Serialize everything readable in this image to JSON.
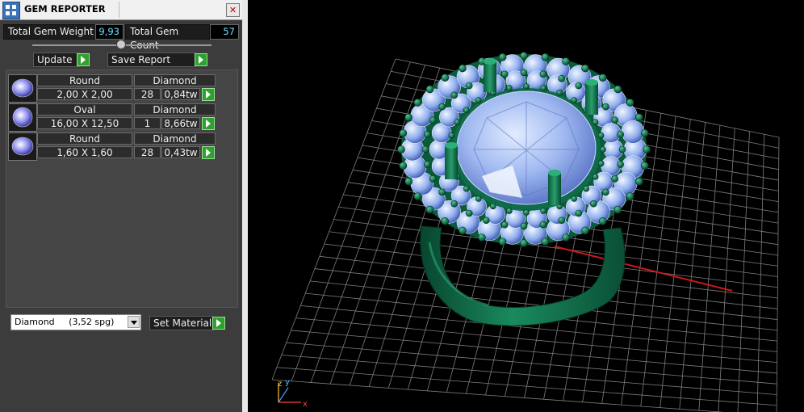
{
  "window": {
    "title": "GEM REPORTER",
    "close_glyph": "✕"
  },
  "stats": {
    "total_weight_label": "Total Gem Weight",
    "total_weight_value": "9,93",
    "total_count_label": "Total Gem Count",
    "total_count_value": "57"
  },
  "buttons": {
    "update": "Update",
    "save_report": "Save Report",
    "set_material": "Set Material"
  },
  "gems": [
    {
      "shape": "Round",
      "material": "Diamond",
      "size": "2,00 X 2,00",
      "count": "28",
      "weight": "0,84tw"
    },
    {
      "shape": "Oval",
      "material": "Diamond",
      "size": "16,00 X 12,50",
      "count": "1",
      "weight": "8,66tw"
    },
    {
      "shape": "Round",
      "material": "Diamond",
      "size": "1,60 X 1,60",
      "count": "28",
      "weight": "0,43tw"
    }
  ],
  "material_select": {
    "name": "Diamond",
    "density": "(3,52 spg)"
  },
  "axes": {
    "x": "x",
    "y": "y",
    "z": "z"
  },
  "colors": {
    "panel": "#3c3c3c",
    "value_text": "#6ee0ff",
    "go_button": "#2ea12e",
    "metal": "#0f6b4a",
    "gem": "#a8c8ff",
    "grid": "#7d7d7d",
    "x_axis": "#d01818"
  }
}
